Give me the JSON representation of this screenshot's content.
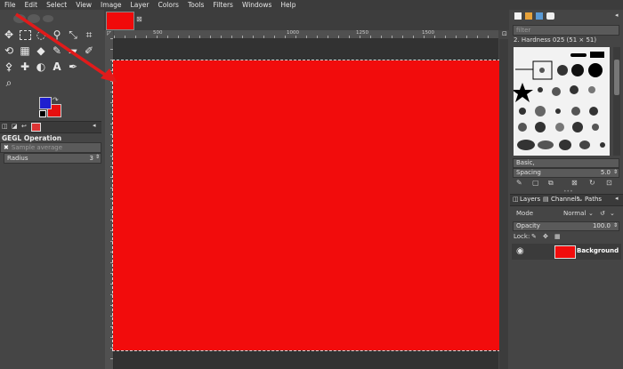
{
  "menu": [
    "File",
    "Edit",
    "Select",
    "View",
    "Image",
    "Layer",
    "Colors",
    "Tools",
    "Filters",
    "Windows",
    "Help"
  ],
  "colors": {
    "canvas": "#f20c0c",
    "foreground": "#1f1fcf",
    "background": "#e60f0f",
    "arrow": "#e01b1b"
  },
  "tool_options": {
    "title": "GEGL Operation",
    "op_placeholder": "Sample average",
    "radius_label": "Radius",
    "radius_value": "3"
  },
  "ruler_ticks": [
    "500",
    "1000",
    "1250",
    "1500"
  ],
  "brushes": {
    "filter_placeholder": "filter",
    "current": "2. Hardness 025 (51 × 51)",
    "tag": "Basic,",
    "spacing_label": "Spacing",
    "spacing_value": "5.0"
  },
  "layers": {
    "tabs": [
      "Layers",
      "Channels",
      "Paths"
    ],
    "mode_label": "Mode",
    "mode_value": "Normal",
    "opacity_label": "Opacity",
    "opacity_value": "100.0",
    "lock_label": "Lock:",
    "items": [
      {
        "name": "Background"
      }
    ]
  }
}
